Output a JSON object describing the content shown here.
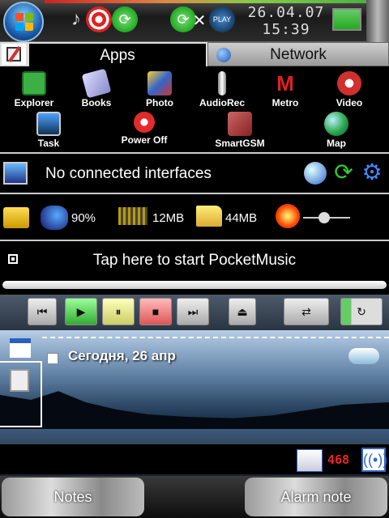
{
  "status": {
    "date": "26.04.07",
    "time": "15:39"
  },
  "tabs": [
    {
      "label": "Apps"
    },
    {
      "label": "Network"
    }
  ],
  "apps": [
    {
      "label": "Explorer",
      "icon": "floppy-icon",
      "color": "#3cb043"
    },
    {
      "label": "Books",
      "icon": "books-icon",
      "color": "#c7c7ff"
    },
    {
      "label": "Photo",
      "icon": "camera-icon",
      "color": "#3b6bd6"
    },
    {
      "label": "AudioRec",
      "icon": "microphone-icon",
      "color": "#cccccc"
    },
    {
      "label": "Metro",
      "icon": "metro-icon",
      "color": "#e02020"
    },
    {
      "label": "Video",
      "icon": "film-icon",
      "color": "#d03030"
    },
    {
      "label": "Task",
      "icon": "monitor-icon",
      "color": "#4ca2ff"
    },
    {
      "label": "Power Off",
      "icon": "power-icon",
      "color": "#e32b2b"
    },
    {
      "label": "SmartGSM",
      "icon": "phone-icon",
      "color": "#b03030"
    },
    {
      "label": "Map",
      "icon": "globe-icon",
      "color": "#2aa84a"
    }
  ],
  "network": {
    "text": "No connected interfaces"
  },
  "system": {
    "cpu": "90%",
    "memory": "12MB",
    "storage": "44MB",
    "brightness_level": 0.45
  },
  "music": {
    "text": "Tap here to start PocketMusic"
  },
  "today": {
    "text": "Сегодня, 26 апр"
  },
  "tray": {
    "counter": "468"
  },
  "softkeys": {
    "left": "Notes",
    "right": "Alarm note"
  }
}
